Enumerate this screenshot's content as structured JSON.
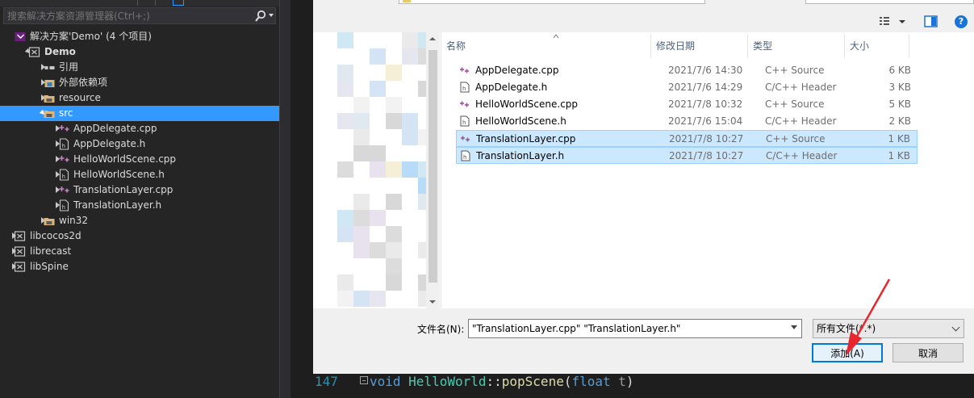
{
  "solution_explorer": {
    "search_placeholder": "搜索解决方案资源管理器(Ctrl+;)",
    "icons": {
      "search": "magnifier-icon",
      "dropdown": "chevron-down-icon"
    },
    "items": [
      {
        "label": "解决方案'Demo' (4 个项目)",
        "icon": "solution-icon",
        "arrow": "none",
        "bold": false,
        "selected": false
      },
      {
        "label": "Demo",
        "icon": "project-icon",
        "arrow": "down",
        "bold": true,
        "selected": false
      },
      {
        "label": "引用",
        "icon": "references-icon",
        "arrow": "right",
        "bold": false,
        "selected": false
      },
      {
        "label": "外部依赖项",
        "icon": "external-deps-icon",
        "arrow": "right",
        "bold": false,
        "selected": false
      },
      {
        "label": "resource",
        "icon": "filter-folder-icon",
        "arrow": "right",
        "bold": false,
        "selected": false
      },
      {
        "label": "src",
        "icon": "filter-folder-icon",
        "arrow": "down",
        "bold": false,
        "selected": true
      },
      {
        "label": "AppDelegate.cpp",
        "icon": "cpp-file-icon",
        "arrow": "right",
        "bold": false,
        "selected": false
      },
      {
        "label": "AppDelegate.h",
        "icon": "header-file-icon",
        "arrow": "right",
        "bold": false,
        "selected": false
      },
      {
        "label": "HelloWorldScene.cpp",
        "icon": "cpp-file-icon",
        "arrow": "right",
        "bold": false,
        "selected": false
      },
      {
        "label": "HelloWorldScene.h",
        "icon": "header-file-icon",
        "arrow": "right",
        "bold": false,
        "selected": false
      },
      {
        "label": "TranslationLayer.cpp",
        "icon": "cpp-file-icon",
        "arrow": "right",
        "bold": false,
        "selected": false
      },
      {
        "label": "TranslationLayer.h",
        "icon": "header-file-icon",
        "arrow": "right",
        "bold": false,
        "selected": false
      },
      {
        "label": "win32",
        "icon": "filter-folder-icon",
        "arrow": "right",
        "bold": false,
        "selected": false
      },
      {
        "label": "libcocos2d",
        "icon": "project-icon",
        "arrow": "right",
        "bold": false,
        "selected": false
      },
      {
        "label": "librecast",
        "icon": "project-icon",
        "arrow": "right",
        "bold": false,
        "selected": false
      },
      {
        "label": "libSpine",
        "icon": "project-icon",
        "arrow": "right",
        "bold": false,
        "selected": false
      }
    ]
  },
  "code": {
    "line_number": "147",
    "kw_void": "void",
    "class_name": "HelloWorld",
    "scope": "::",
    "func_name": "popScene",
    "paren_open": "(",
    "kw_float": "float",
    "param": "t",
    "paren_close": ")"
  },
  "dialog": {
    "help_label": "?",
    "view_icon": "details-view-icon",
    "pane_icon": "preview-pane-icon",
    "columns": {
      "name": "名称",
      "date": "修改日期",
      "type": "类型",
      "size": "大小"
    },
    "files": [
      {
        "name": "AppDelegate.cpp",
        "date": "2021/7/6 14:30",
        "type": "C++ Source",
        "size": "6 KB",
        "kind": "cpp",
        "selected": false
      },
      {
        "name": "AppDelegate.h",
        "date": "2021/7/6 14:29",
        "type": "C/C++ Header",
        "size": "3 KB",
        "kind": "h",
        "selected": false
      },
      {
        "name": "HelloWorldScene.cpp",
        "date": "2021/7/8 10:32",
        "type": "C++ Source",
        "size": "5 KB",
        "kind": "cpp",
        "selected": false
      },
      {
        "name": "HelloWorldScene.h",
        "date": "2021/7/6 15:04",
        "type": "C/C++ Header",
        "size": "2 KB",
        "kind": "h",
        "selected": false
      },
      {
        "name": "TranslationLayer.cpp",
        "date": "2021/7/8 10:27",
        "type": "C++ Source",
        "size": "1 KB",
        "kind": "cpp",
        "selected": true
      },
      {
        "name": "TranslationLayer.h",
        "date": "2021/7/8 10:27",
        "type": "C/C++ Header",
        "size": "1 KB",
        "kind": "h",
        "selected": true
      }
    ],
    "filename_label": "文件名(N):",
    "filename_value": "\"TranslationLayer.cpp\" \"TranslationLayer.h\"",
    "filter_value": "所有文件(*.*)",
    "add_label": "添加(A)",
    "cancel_label": "取消",
    "colors": {
      "selection": "#cce8ff",
      "accent": "#0078d7",
      "annotation": "#e8262d"
    }
  }
}
